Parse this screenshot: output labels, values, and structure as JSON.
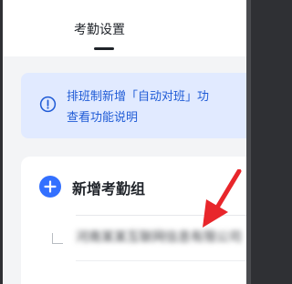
{
  "header": {
    "tab": "考勤设置"
  },
  "notice": {
    "icon": "info-icon",
    "line1": "排班制新增「自动对班」功",
    "line2": "查看功能说明",
    "color": "#1f5bd6"
  },
  "card": {
    "add_icon": "plus-circle-icon",
    "add_label": "新增考勤组",
    "group_name": "河南某某互联网信息有限公司",
    "accent": "#3370ff"
  },
  "annotation": {
    "icon": "red-arrow-icon",
    "color": "#e8262b"
  }
}
